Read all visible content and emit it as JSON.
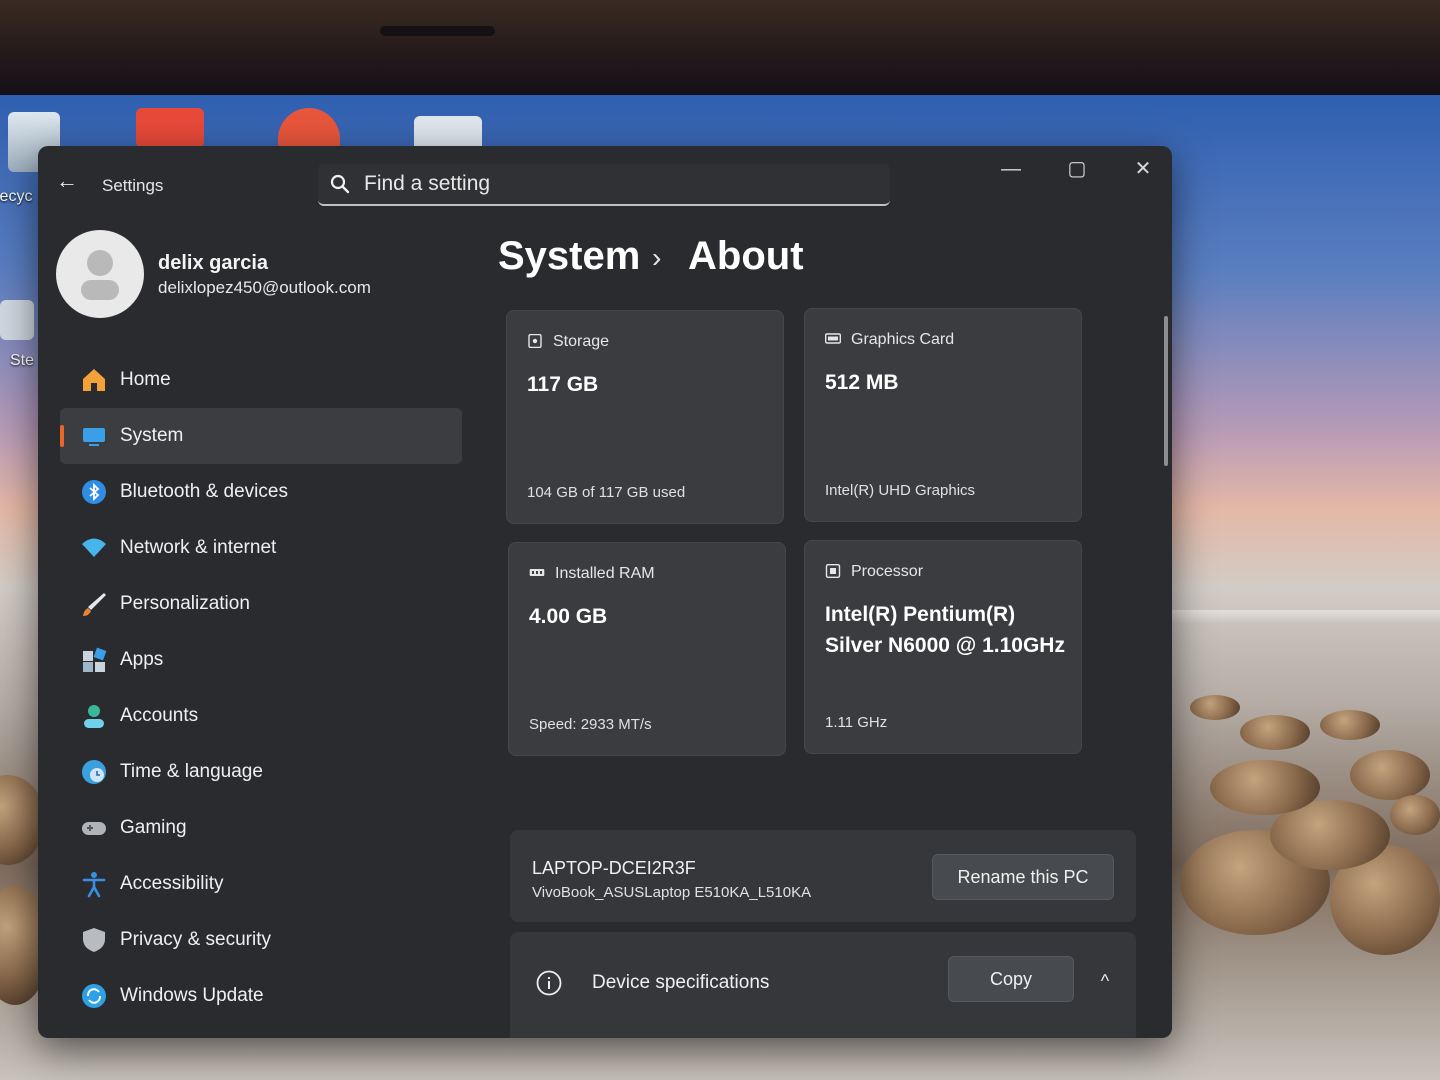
{
  "desktop": {
    "recycle_label": "Recyc",
    "steam_label": "Ste"
  },
  "window": {
    "app_title": "Settings",
    "search_placeholder": "Find a setting",
    "minimize_glyph": "—",
    "maximize_glyph": "▢",
    "close_glyph": "✕",
    "back_glyph": "←"
  },
  "user": {
    "name": "delix garcia",
    "email": "delixlopez450@outlook.com"
  },
  "nav": [
    {
      "label": "Home",
      "icon": "home-icon",
      "color": "#f3a23a"
    },
    {
      "label": "System",
      "icon": "system-icon",
      "color": "#3a9ee8"
    },
    {
      "label": "Bluetooth & devices",
      "icon": "bluetooth-icon",
      "color": "#2f8de4"
    },
    {
      "label": "Network & internet",
      "icon": "wifi-icon",
      "color": "#48b4ec"
    },
    {
      "label": "Personalization",
      "icon": "brush-icon",
      "color": "#e8843a"
    },
    {
      "label": "Apps",
      "icon": "apps-icon",
      "color": "#9fb6c8"
    },
    {
      "label": "Accounts",
      "icon": "accounts-icon",
      "color": "#38b89a"
    },
    {
      "label": "Time & language",
      "icon": "globe-clock-icon",
      "color": "#3aa0e0"
    },
    {
      "label": "Gaming",
      "icon": "controller-icon",
      "color": "#b0b4b8"
    },
    {
      "label": "Accessibility",
      "icon": "accessibility-icon",
      "color": "#3a8fe0"
    },
    {
      "label": "Privacy & security",
      "icon": "shield-icon",
      "color": "#b8bcc0"
    },
    {
      "label": "Windows Update",
      "icon": "update-icon",
      "color": "#2fa0e6"
    }
  ],
  "selected_nav": "System",
  "breadcrumb": {
    "parent": "System",
    "separator": "›",
    "current": "About"
  },
  "cards": {
    "storage": {
      "title": "Storage",
      "value": "117 GB",
      "sub": "104 GB of 117 GB used",
      "icon": "storage-icon"
    },
    "graphics": {
      "title": "Graphics Card",
      "value": "512 MB",
      "sub": "Intel(R) UHD Graphics",
      "icon": "graphics-card-icon"
    },
    "ram": {
      "title": "Installed RAM",
      "value": "4.00 GB",
      "sub": "Speed: 2933 MT/s",
      "icon": "ram-icon"
    },
    "processor": {
      "title": "Processor",
      "value": "Intel(R) Pentium(R) Silver N6000 @ 1.10GHz",
      "sub": "1.11 GHz",
      "icon": "processor-icon"
    }
  },
  "pc": {
    "name": "LAPTOP-DCEI2R3F",
    "model": "VivoBook_ASUSLaptop E510KA_L510KA",
    "rename_label": "Rename this PC"
  },
  "specs": {
    "title": "Device specifications",
    "copy_label": "Copy",
    "chevron_glyph": "^"
  },
  "colors": {
    "accent": "#e8682a",
    "window_bg": "#292b2e",
    "card_bg": "#3a3c3f"
  }
}
